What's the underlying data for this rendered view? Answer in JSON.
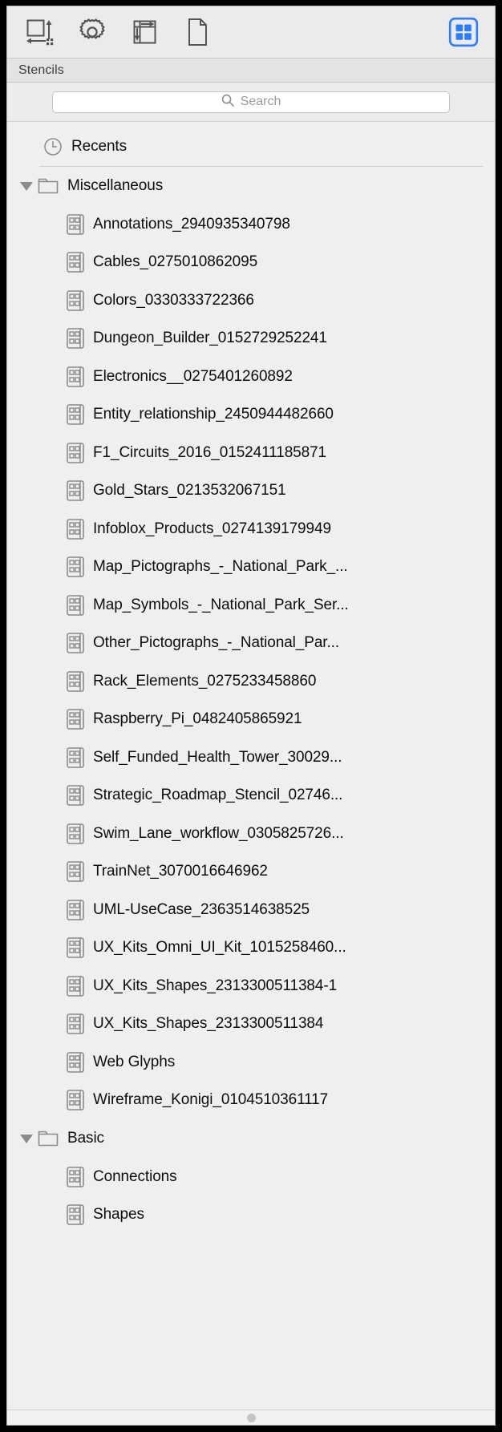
{
  "toolbar": {
    "buttons": [
      {
        "name": "resize-canvas-icon",
        "label": "Canvas Size"
      },
      {
        "name": "gear-icon",
        "label": "Settings"
      },
      {
        "name": "layout-guides-icon",
        "label": "Alignment"
      },
      {
        "name": "document-page-icon",
        "label": "Document"
      }
    ],
    "active_button": {
      "name": "stencils-grid-icon",
      "label": "Stencils",
      "color": "#2b7fff"
    }
  },
  "header": {
    "title": "Stencils"
  },
  "search": {
    "placeholder": "Search",
    "value": "",
    "icon": "search-icon"
  },
  "list": {
    "recents": {
      "label": "Recents",
      "icon": "clock-icon"
    },
    "groups": [
      {
        "label": "Miscellaneous",
        "icon": "folder-icon",
        "expanded": true,
        "items": [
          "Annotations_2940935340798",
          "Cables_0275010862095",
          "Colors_0330333722366",
          "Dungeon_Builder_0152729252241",
          "Electronics__0275401260892",
          "Entity_relationship_2450944482660",
          "F1_Circuits_2016_0152411185871",
          "Gold_Stars_0213532067151",
          "Infoblox_Products_0274139179949",
          "Map_Pictographs_-_National_Park_...",
          "Map_Symbols_-_National_Park_Ser...",
          "Other_Pictographs_-_National_Par...",
          "Rack_Elements_0275233458860",
          "Raspberry_Pi_0482405865921",
          "Self_Funded_Health_Tower_30029...",
          "Strategic_Roadmap_Stencil_02746...",
          "Swim_Lane_workflow_0305825726...",
          "TrainNet_3070016646962",
          "UML-UseCase_2363514638525",
          "UX_Kits_Omni_UI_Kit_1015258460...",
          "UX_Kits_Shapes_2313300511384-1",
          "UX_Kits_Shapes_2313300511384",
          "Web Glyphs",
          "Wireframe_Konigi_0104510361117"
        ]
      },
      {
        "label": "Basic",
        "icon": "folder-icon",
        "expanded": true,
        "items": [
          "Connections",
          "Shapes"
        ]
      }
    ]
  },
  "scrollbar": {
    "name": "horizontal-scrollbar",
    "thumb_position": "center"
  }
}
